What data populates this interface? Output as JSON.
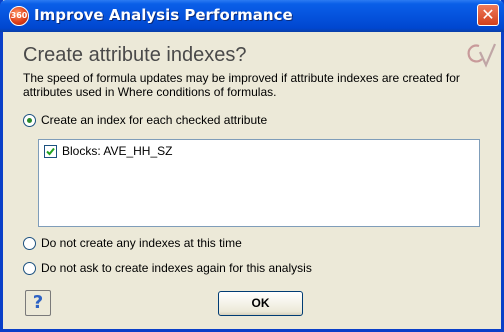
{
  "window": {
    "title": "Improve Analysis Performance",
    "app_icon": "360-badge-icon",
    "close_glyph": "✕"
  },
  "header": {
    "title": "Create attribute indexes?",
    "logo": "cv-logo"
  },
  "description": "The speed of formula updates may be improved if attribute indexes are created for attributes used in Where conditions of formulas.",
  "options": {
    "create_index": {
      "label": "Create an index for each checked attribute",
      "selected": true
    },
    "do_not_create": {
      "label": "Do not create any  indexes at this time",
      "selected": false
    },
    "do_not_ask": {
      "label": "Do not ask to create indexes again for this analysis",
      "selected": false
    }
  },
  "attributes": [
    {
      "label": "Blocks: AVE_HH_SZ",
      "checked": true
    }
  ],
  "buttons": {
    "help_icon": "help-question-icon",
    "help_glyph": "?",
    "ok_label": "OK"
  },
  "colors": {
    "titlebar": "#0553DD",
    "dialog_bg": "#ECE9D8",
    "radio_dot": "#2b8a2b"
  }
}
